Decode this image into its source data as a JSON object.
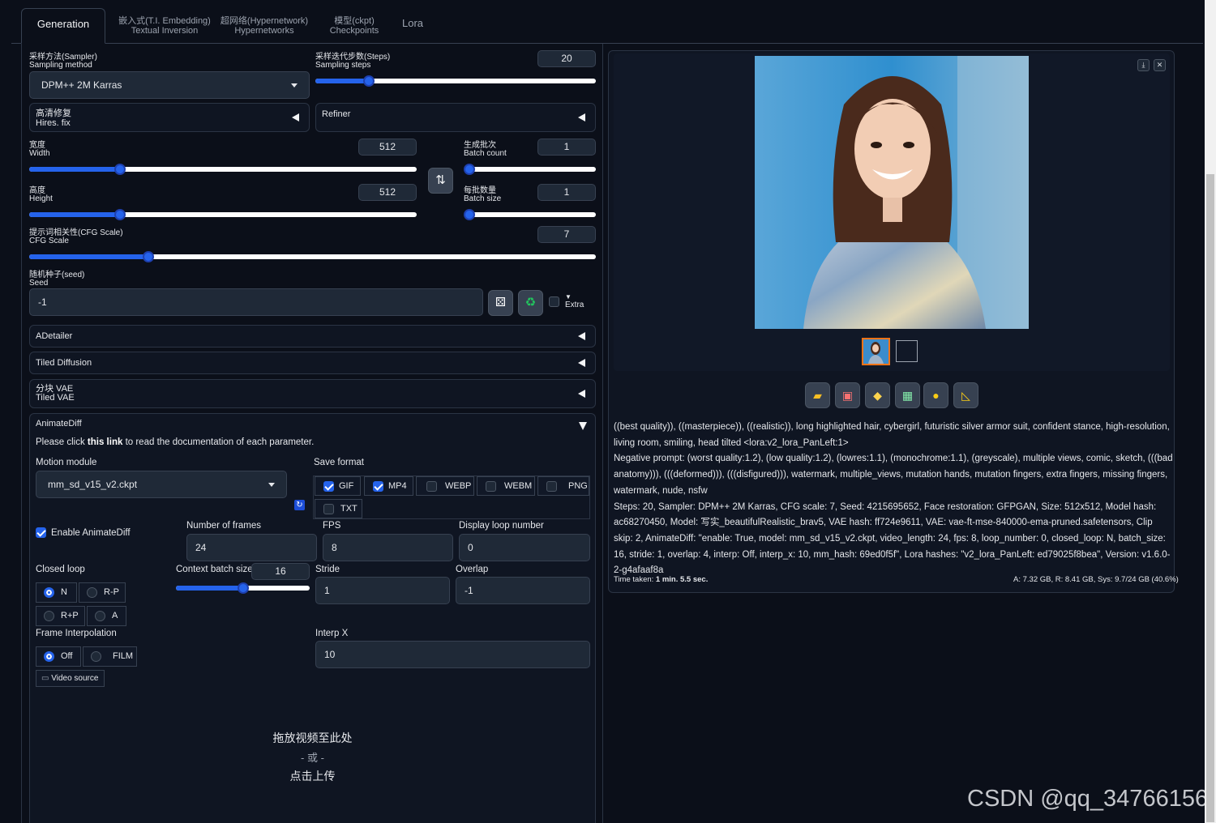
{
  "tabs": [
    {
      "label": "Generation",
      "sub": ""
    },
    {
      "label": "嵌入式(T.I. Embedding)",
      "sub": "Textual Inversion"
    },
    {
      "label": "超网络(Hypernetwork)",
      "sub": "Hypernetworks"
    },
    {
      "label": "模型(ckpt)",
      "sub": "Checkpoints"
    },
    {
      "label": "Lora",
      "sub": ""
    }
  ],
  "sampler": {
    "cn": "采样方法(Sampler)",
    "en": "Sampling method",
    "value": "DPM++ 2M Karras"
  },
  "steps": {
    "cn": "采样迭代步数(Steps)",
    "en": "Sampling steps",
    "value": "20",
    "fraction": 0.19
  },
  "hires": {
    "cn": "高清修复",
    "en": "Hires. fix"
  },
  "refiner": {
    "label": "Refiner"
  },
  "width": {
    "cn": "宽度",
    "en": "Width",
    "value": "512",
    "fraction": 0.235
  },
  "height": {
    "cn": "高度",
    "en": "Height",
    "value": "512",
    "fraction": 0.235
  },
  "batch_count": {
    "cn": "生成批次",
    "en": "Batch count",
    "value": "1",
    "fraction": 0.0
  },
  "batch_size": {
    "cn": "每批数量",
    "en": "Batch size",
    "value": "1",
    "fraction": 0.0
  },
  "cfg": {
    "cn": "提示词相关性(CFG Scale)",
    "en": "CFG Scale",
    "value": "7",
    "fraction": 0.21
  },
  "seed": {
    "cn": "随机种子(seed)",
    "en": "Seed",
    "value": "-1",
    "extra": "Extra"
  },
  "accordions": {
    "adetailer": "ADetailer",
    "tiled_diffusion": "Tiled Diffusion",
    "tiled_vae_cn": "分块 VAE",
    "tiled_vae_en": "Tiled VAE",
    "animatediff": "AnimateDiff"
  },
  "animatediff": {
    "doc_pre": "Please click ",
    "doc_link": "this link",
    "doc_post": " to read the documentation of each parameter.",
    "motion_module_label": "Motion module",
    "motion_module_value": "mm_sd_v15_v2.ckpt",
    "save_format_label": "Save format",
    "formats": [
      {
        "name": "GIF",
        "checked": true
      },
      {
        "name": "MP4",
        "checked": true
      },
      {
        "name": "WEBP",
        "checked": false
      },
      {
        "name": "WEBM",
        "checked": false
      },
      {
        "name": "PNG",
        "checked": false
      },
      {
        "name": "TXT",
        "checked": false
      }
    ],
    "enable_label": "Enable AnimateDiff",
    "frames_label": "Number of frames",
    "frames_value": "24",
    "fps_label": "FPS",
    "fps_value": "8",
    "loop_label": "Display loop number",
    "loop_value": "0",
    "closed_loop_label": "Closed loop",
    "closed_loop_options": [
      "N",
      "R-P",
      "R+P",
      "A"
    ],
    "closed_loop_selected": "N",
    "context_label": "Context batch size",
    "context_value": "16",
    "context_fraction": 0.5,
    "stride_label": "Stride",
    "stride_value": "1",
    "overlap_label": "Overlap",
    "overlap_value": "-1",
    "interp_label": "Frame Interpolation",
    "interp_options": [
      "Off",
      "FILM"
    ],
    "interp_selected": "Off",
    "interpx_label": "Interp X",
    "interpx_value": "10",
    "video_source": "Video source",
    "drop_text": "拖放视频至此处",
    "or_text": "- 或 -",
    "upload_text": "点击上传"
  },
  "output": {
    "prompt": "((best quality)), ((masterpiece)), ((realistic)), long highlighted hair, cybergirl, futuristic silver armor suit, confident stance, high-resolution, living room, smiling, head tilted <lora:v2_lora_PanLeft:1>",
    "negative": "Negative prompt: (worst quality:1.2), (low quality:1.2), (lowres:1.1), (monochrome:1.1), (greyscale), multiple views, comic, sketch, (((bad anatomy))), (((deformed))), (((disfigured))), watermark, multiple_views, mutation hands, mutation fingers, extra fingers, missing fingers, watermark, nude, nsfw",
    "params": "Steps: 20, Sampler: DPM++ 2M Karras, CFG scale: 7, Seed: 4215695652, Face restoration: GFPGAN, Size: 512x512, Model hash: ac68270450, Model: 写实_beautifulRealistic_brav5, VAE hash: ff724e9611, VAE: vae-ft-mse-840000-ema-pruned.safetensors, Clip skip: 2, AnimateDiff: \"enable: True, model: mm_sd_v15_v2.ckpt, video_length: 24, fps: 8, loop_number: 0, closed_loop: N, batch_size: 16, stride: 1, overlap: 4, interp: Off, interp_x: 10, mm_hash: 69ed0f5f\", Lora hashes: \"v2_lora_PanLeft: ed79025f8bea\", Version: v1.6.0-2-g4afaaf8a",
    "time_label": "Time taken: ",
    "time_value": "1 min. 5.5 sec.",
    "vram": "A: 7.32 GB, R: 8.41 GB, Sys: 9.7/24 GB (40.6%)",
    "watermark": "CSDN @qq_34766156"
  },
  "colors": {
    "accent": "#2563eb",
    "bg": "#0b0f19",
    "panel": "#0f1522"
  },
  "icons": [
    "dice-icon",
    "recycle-icon",
    "folder-icon",
    "save-icon",
    "zip-icon",
    "image-icon",
    "palette-icon",
    "ruler-icon",
    "download-icon",
    "close-icon",
    "refresh-icon",
    "video-icon"
  ]
}
